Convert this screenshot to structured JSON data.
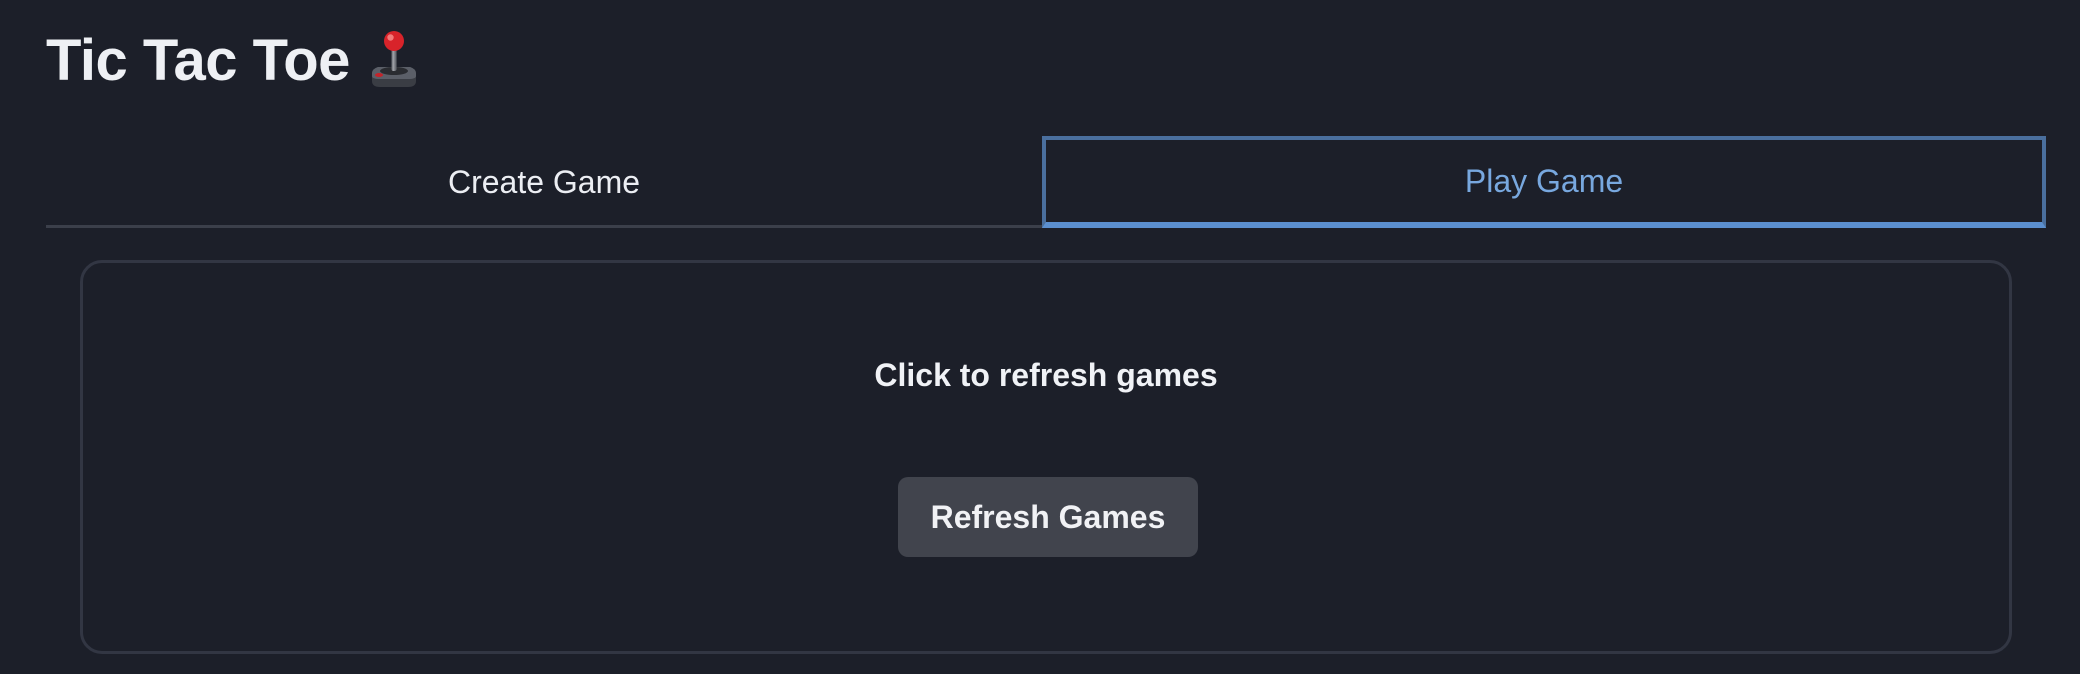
{
  "header": {
    "title": "Tic Tac Toe",
    "title_icon": "joystick-icon"
  },
  "tabs": [
    {
      "label": "Create Game",
      "selected": false
    },
    {
      "label": "Play Game",
      "selected": true
    }
  ],
  "play_panel": {
    "heading": "Click to refresh games",
    "refresh_button_label": "Refresh Games"
  },
  "colors": {
    "background": "#1c1f29",
    "accent": "#78a8df",
    "tab_border": "#4a6f9e",
    "button_bg": "#41444d"
  }
}
